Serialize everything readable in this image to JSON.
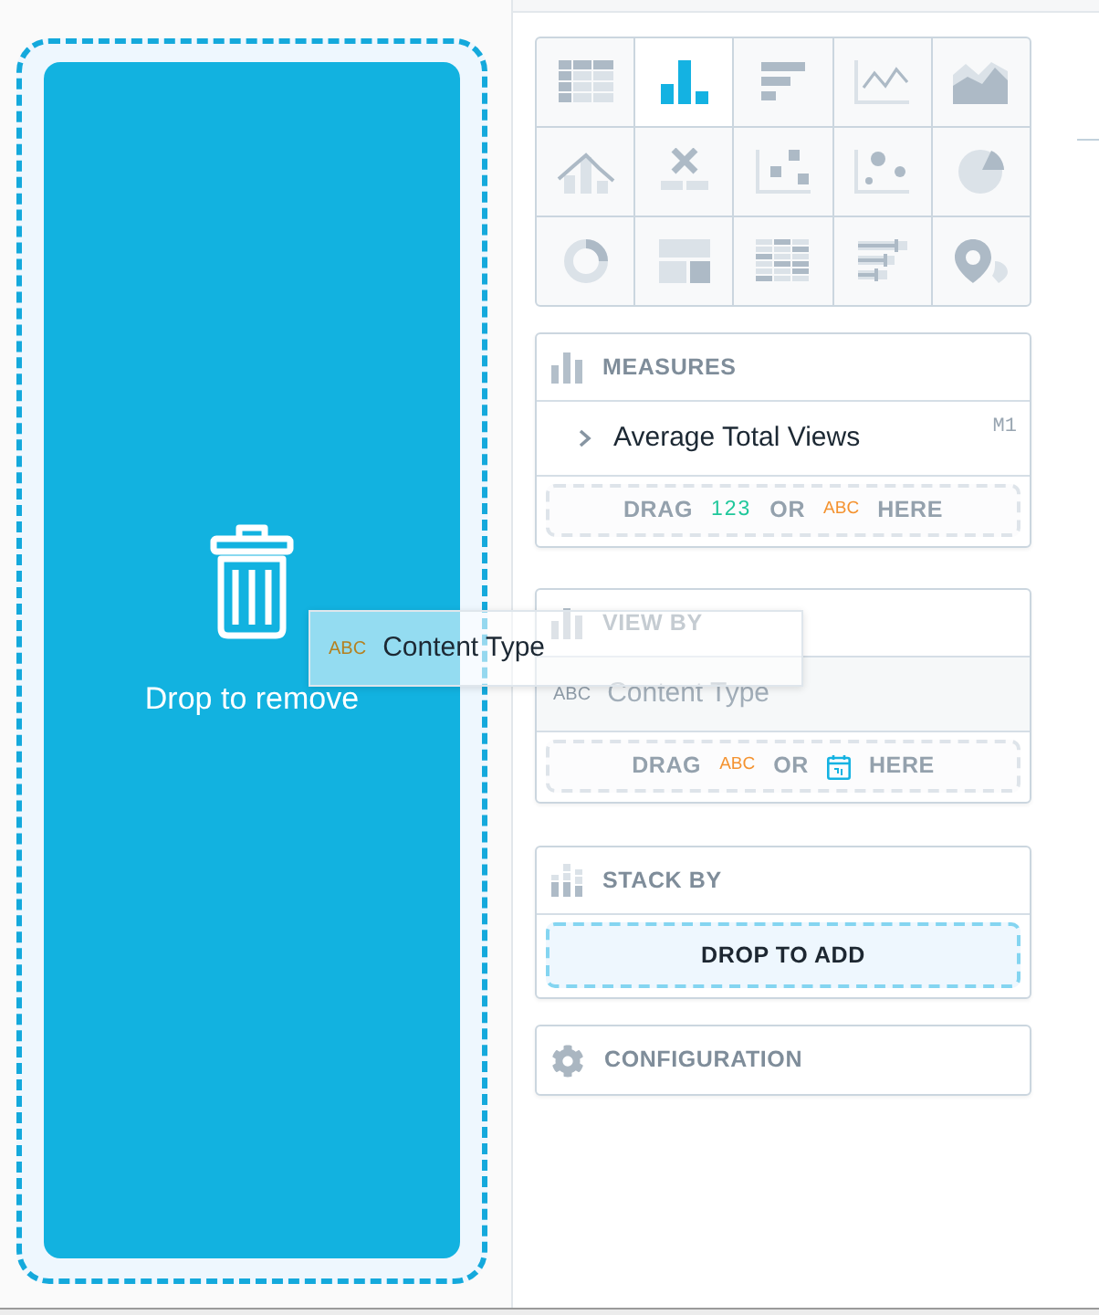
{
  "drop_target": {
    "label": "Drop to remove"
  },
  "chart_types": [
    {
      "selected": false
    },
    {
      "selected": true
    },
    {
      "selected": false
    },
    {
      "selected": false
    },
    {
      "selected": false
    },
    {
      "selected": false
    },
    {
      "selected": false
    },
    {
      "selected": false
    },
    {
      "selected": false
    },
    {
      "selected": false
    },
    {
      "selected": false
    },
    {
      "selected": false
    },
    {
      "selected": false
    },
    {
      "selected": false
    },
    {
      "selected": false
    }
  ],
  "buckets": [
    {
      "kind": "measures",
      "title": "MEASURES",
      "items": [
        {
          "name": "Average Total Views",
          "id": "M1",
          "expanded": false
        }
      ],
      "drop_hint": {
        "highlighted": false,
        "parts": [
          {
            "kind": "word",
            "text": "DRAG"
          },
          {
            "kind": "number",
            "text": "123"
          },
          {
            "kind": "word",
            "text": "OR"
          },
          {
            "kind": "attribute",
            "text": "ABC"
          },
          {
            "kind": "word",
            "text": "HERE"
          }
        ]
      }
    },
    {
      "kind": "view_by",
      "title": "VIEW BY",
      "items": [
        {
          "type_label": "ABC",
          "name": "Content Type",
          "dragging": true
        }
      ],
      "drop_hint": {
        "highlighted": false,
        "parts": [
          {
            "kind": "word",
            "text": "DRAG"
          },
          {
            "kind": "attribute",
            "text": "ABC"
          },
          {
            "kind": "word",
            "text": "OR"
          },
          {
            "kind": "date"
          },
          {
            "kind": "word",
            "text": "HERE"
          }
        ]
      }
    },
    {
      "kind": "stack_by",
      "title": "STACK BY",
      "drop_hint": {
        "highlighted": true,
        "parts": [
          {
            "kind": "word",
            "text": "DROP TO ADD"
          }
        ]
      }
    },
    {
      "kind": "configuration",
      "title": "CONFIGURATION"
    }
  ],
  "drag_preview": {
    "type_label": "ABC",
    "name": "Content Type"
  }
}
